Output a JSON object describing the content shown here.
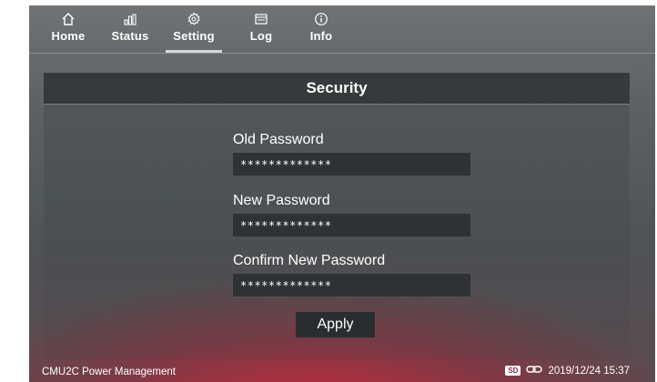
{
  "nav": {
    "items": [
      {
        "label": "Home",
        "icon": "home-icon"
      },
      {
        "label": "Status",
        "icon": "bar-chart-icon"
      },
      {
        "label": "Setting",
        "icon": "gear-icon",
        "active": true
      },
      {
        "label": "Log",
        "icon": "log-icon"
      },
      {
        "label": "Info",
        "icon": "info-icon"
      }
    ]
  },
  "panel": {
    "title": "Security",
    "old_password": {
      "label": "Old Password",
      "value": "*************"
    },
    "new_password": {
      "label": "New Password",
      "value": "*************"
    },
    "confirm_password": {
      "label": "Confirm New Password",
      "value": "*************"
    },
    "apply_label": "Apply"
  },
  "statusbar": {
    "app_name": "CMU2C Power Management",
    "sd_label": "SD",
    "datetime": "2019/12/24 15:37"
  }
}
